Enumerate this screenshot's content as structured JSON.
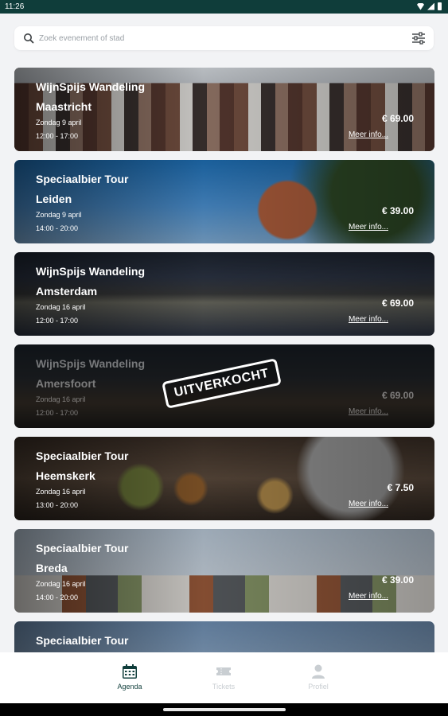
{
  "status_bar": {
    "time": "11:26"
  },
  "search": {
    "placeholder": "Zoek evenement of stad",
    "value": ""
  },
  "events": [
    {
      "title_line1": "WijnSpijs Wandeling",
      "title_line2": "Maastricht",
      "date": "Zondag 9 april",
      "time": "12:00 - 17:00",
      "price": "€ 69.00",
      "more": "Meer info...",
      "sold_out": false
    },
    {
      "title_line1": "Speciaalbier Tour",
      "title_line2": "Leiden",
      "date": "Zondag 9 april",
      "time": "14:00 - 20:00",
      "price": "€ 39.00",
      "more": "Meer info...",
      "sold_out": false
    },
    {
      "title_line1": "WijnSpijs Wandeling",
      "title_line2": "Amsterdam",
      "date": "Zondag 16 april",
      "time": "12:00 - 17:00",
      "price": "€ 69.00",
      "more": "Meer info...",
      "sold_out": false
    },
    {
      "title_line1": "WijnSpijs Wandeling",
      "title_line2": "Amersfoort",
      "date": "Zondag 16 april",
      "time": "12:00 - 17:00",
      "price": "€ 69.00",
      "more": "Meer info...",
      "sold_out": true,
      "badge": "UITVERKOCHT"
    },
    {
      "title_line1": "Speciaalbier Tour",
      "title_line2": "Heemskerk",
      "date": "Zondag 16 april",
      "time": "13:00 - 20:00",
      "price": "€ 7.50",
      "more": "Meer info...",
      "sold_out": false
    },
    {
      "title_line1": "Speciaalbier Tour",
      "title_line2": "Breda",
      "date": "Zondag 16 april",
      "time": "14:00 - 20:00",
      "price": "€ 39.00",
      "more": "Meer info...",
      "sold_out": false
    },
    {
      "title_line1": "Speciaalbier Tour"
    }
  ],
  "tabs": [
    {
      "label": "Agenda",
      "icon": "calendar-icon",
      "active": true
    },
    {
      "label": "Tickets",
      "icon": "ticket-icon",
      "active": false
    },
    {
      "label": "Profiel",
      "icon": "person-icon",
      "active": false
    }
  ],
  "colors": {
    "brand": "#0f3d3a",
    "inactive_tab": "#c9ced2",
    "background": "#f2f3f5"
  }
}
